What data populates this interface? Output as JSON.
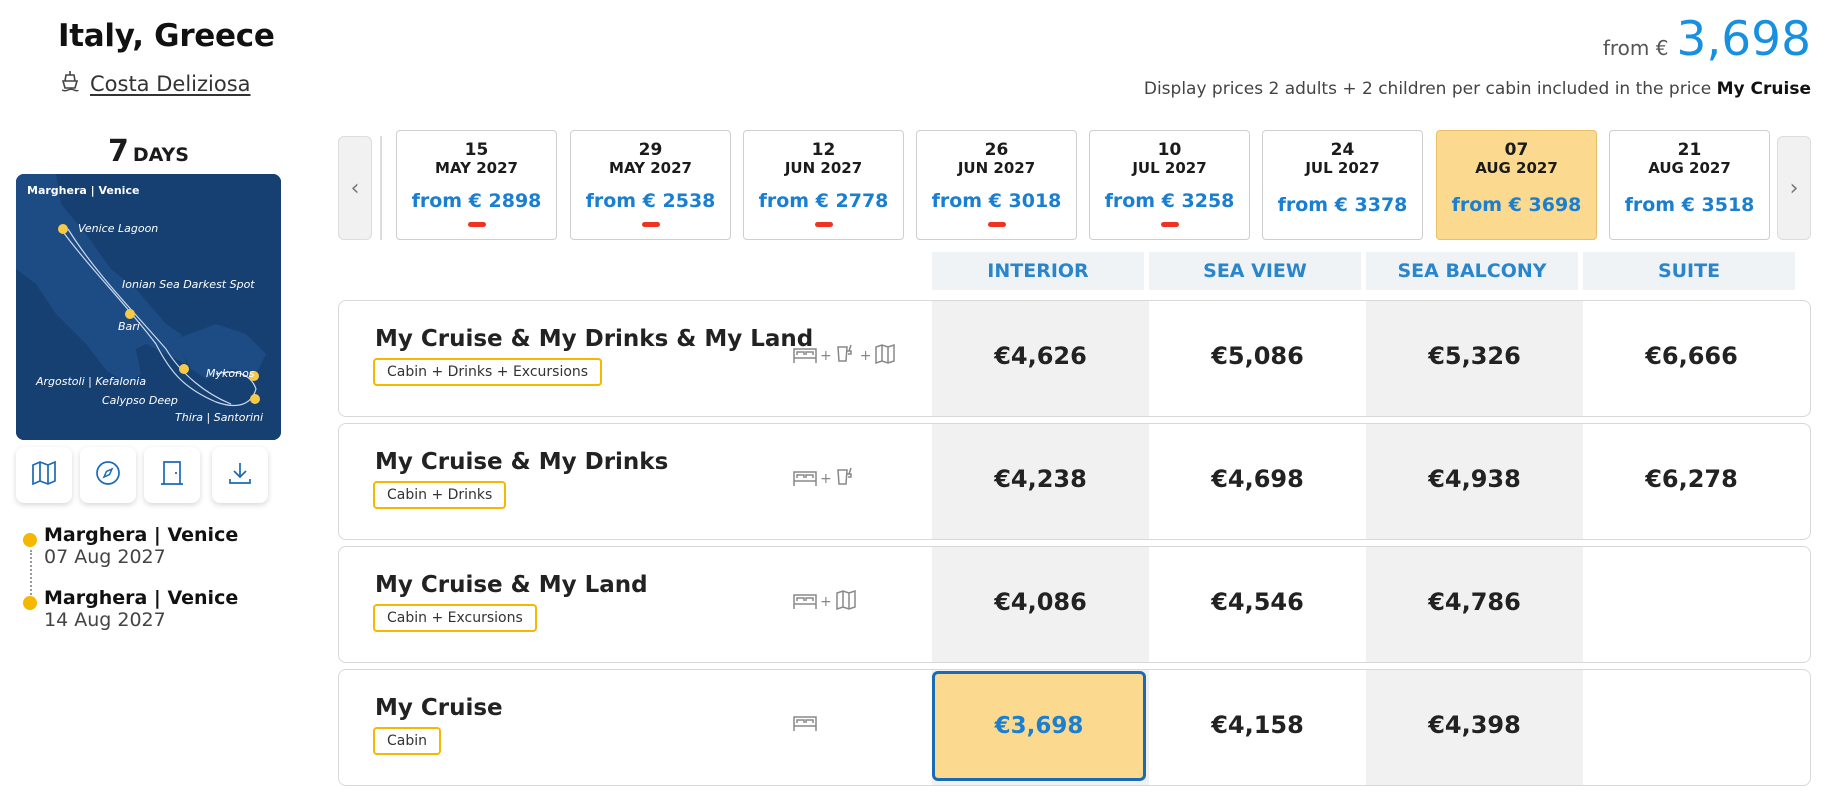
{
  "header": {
    "title": "Italy, Greece",
    "ship_name": "Costa Deliziosa",
    "from_label": "from €",
    "from_price": "3,698",
    "display_note_prefix": "Display prices 2 adults + 2 children per cabin included in the price",
    "display_note_bold": "My Cruise"
  },
  "duration": {
    "number": "7",
    "label": "DAYS"
  },
  "map": {
    "title": "Marghera | Venice",
    "labels": [
      "Venice Lagoon",
      "Ionian Sea Darkest Spot",
      "Bari",
      "Mykonos",
      "Argostoli | Kefalonia",
      "Calypso Deep",
      "Thira | Santorini"
    ]
  },
  "tools": [
    "map-icon",
    "compass-icon",
    "door-icon",
    "download-icon"
  ],
  "itinerary": [
    {
      "port": "Marghera | Venice",
      "date": "07 Aug 2027"
    },
    {
      "port": "Marghera | Venice",
      "date": "14 Aug 2027"
    }
  ],
  "dates": [
    {
      "day": "15",
      "month": "MAY 2027",
      "price": "from € 2898",
      "dash": true,
      "selected": false
    },
    {
      "day": "29",
      "month": "MAY 2027",
      "price": "from € 2538",
      "dash": true,
      "selected": false
    },
    {
      "day": "12",
      "month": "JUN 2027",
      "price": "from € 2778",
      "dash": true,
      "selected": false
    },
    {
      "day": "26",
      "month": "JUN 2027",
      "price": "from € 3018",
      "dash": true,
      "selected": false
    },
    {
      "day": "10",
      "month": "JUL 2027",
      "price": "from € 3258",
      "dash": true,
      "selected": false
    },
    {
      "day": "24",
      "month": "JUL 2027",
      "price": "from € 3378",
      "dash": false,
      "selected": false
    },
    {
      "day": "07",
      "month": "AUG 2027",
      "price": "from € 3698",
      "dash": false,
      "selected": true
    },
    {
      "day": "21",
      "month": "AUG 2027",
      "price": "from € 3518",
      "dash": false,
      "selected": false
    }
  ],
  "columns": [
    "INTERIOR",
    "SEA VIEW",
    "SEA BALCONY",
    "SUITE"
  ],
  "rows": [
    {
      "name": "My Cruise & My Drinks & My Land",
      "tag": "Cabin + Drinks + Excursions",
      "icons": [
        "bed-icon",
        "drinks-icon",
        "map-icon"
      ],
      "prices": [
        "€4,626",
        "€5,086",
        "€5,326",
        "€6,666"
      ]
    },
    {
      "name": "My Cruise & My Drinks",
      "tag": "Cabin + Drinks",
      "icons": [
        "bed-icon",
        "drinks-icon"
      ],
      "prices": [
        "€4,238",
        "€4,698",
        "€4,938",
        "€6,278"
      ]
    },
    {
      "name": "My Cruise & My Land",
      "tag": "Cabin + Excursions",
      "icons": [
        "bed-icon",
        "map-icon"
      ],
      "prices": [
        "€4,086",
        "€4,546",
        "€4,786",
        ""
      ]
    },
    {
      "name": "My Cruise",
      "tag": "Cabin",
      "icons": [
        "bed-icon"
      ],
      "prices": [
        "€3,698",
        "€4,158",
        "€4,398",
        ""
      ]
    }
  ],
  "colors": {
    "accent": "#1890e0",
    "selected": "#fbd98f",
    "tag_border": "#f5b800",
    "dash": "#ee3322",
    "selected_border": "#1a6bb6"
  }
}
